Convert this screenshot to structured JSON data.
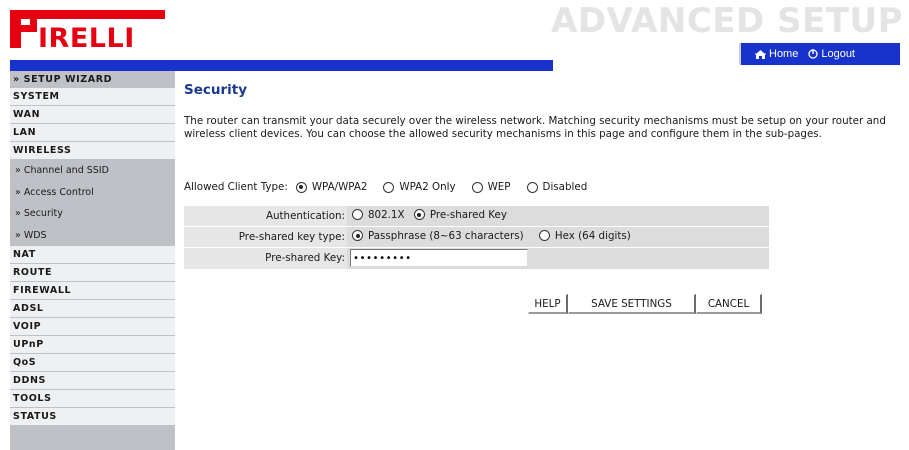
{
  "brand": {
    "logo_text": "IRELLI",
    "logo_color": "#e60012",
    "title": "ADVANCED SETUP",
    "accent": "#1733cc"
  },
  "topnav": {
    "home_label": "Home",
    "logout_label": "Logout"
  },
  "sidebar": {
    "items": [
      {
        "label": "» SETUP WIZARD",
        "type": "wizard"
      },
      {
        "label": "SYSTEM",
        "type": "main"
      },
      {
        "label": "WAN",
        "type": "main"
      },
      {
        "label": "LAN",
        "type": "main"
      },
      {
        "label": "WIRELESS",
        "type": "main"
      },
      {
        "label": "» Channel and SSID",
        "type": "sub"
      },
      {
        "label": "» Access Control",
        "type": "sub"
      },
      {
        "label": "» Security",
        "type": "sub"
      },
      {
        "label": "» WDS",
        "type": "sub"
      },
      {
        "label": "NAT",
        "type": "main"
      },
      {
        "label": "ROUTE",
        "type": "main"
      },
      {
        "label": "FIREWALL",
        "type": "main"
      },
      {
        "label": "ADSL",
        "type": "main"
      },
      {
        "label": "VOIP",
        "type": "main"
      },
      {
        "label": "UPnP",
        "type": "main"
      },
      {
        "label": "QoS",
        "type": "main"
      },
      {
        "label": "DDNS",
        "type": "main"
      },
      {
        "label": "TOOLS",
        "type": "main"
      },
      {
        "label": "STATUS",
        "type": "main"
      }
    ]
  },
  "main": {
    "title": "Security",
    "intro": "The router can transmit your data securely over the wireless network. Matching security mechanisms must be setup on your router and wireless client devices. You can choose the allowed security mechanisms in this page and configure them in the sub-pages.",
    "client_type": {
      "label": "Allowed Client Type:",
      "options": [
        "WPA/WPA2",
        "WPA2 Only",
        "WEP",
        "Disabled"
      ],
      "selected": "WPA/WPA2"
    },
    "authentication": {
      "label": "Authentication:",
      "options": [
        "802.1X",
        "Pre-shared Key"
      ],
      "selected": "Pre-shared Key"
    },
    "psk_type": {
      "label": "Pre-shared key type:",
      "options": [
        "Passphrase (8~63 characters)",
        "Hex (64 digits)"
      ],
      "selected": "Passphrase (8~63 characters)"
    },
    "psk": {
      "label": "Pre-shared Key:",
      "value": "•••••••••"
    }
  },
  "buttons": {
    "help": "HELP",
    "save": "SAVE SETTINGS",
    "cancel": "CANCEL"
  }
}
